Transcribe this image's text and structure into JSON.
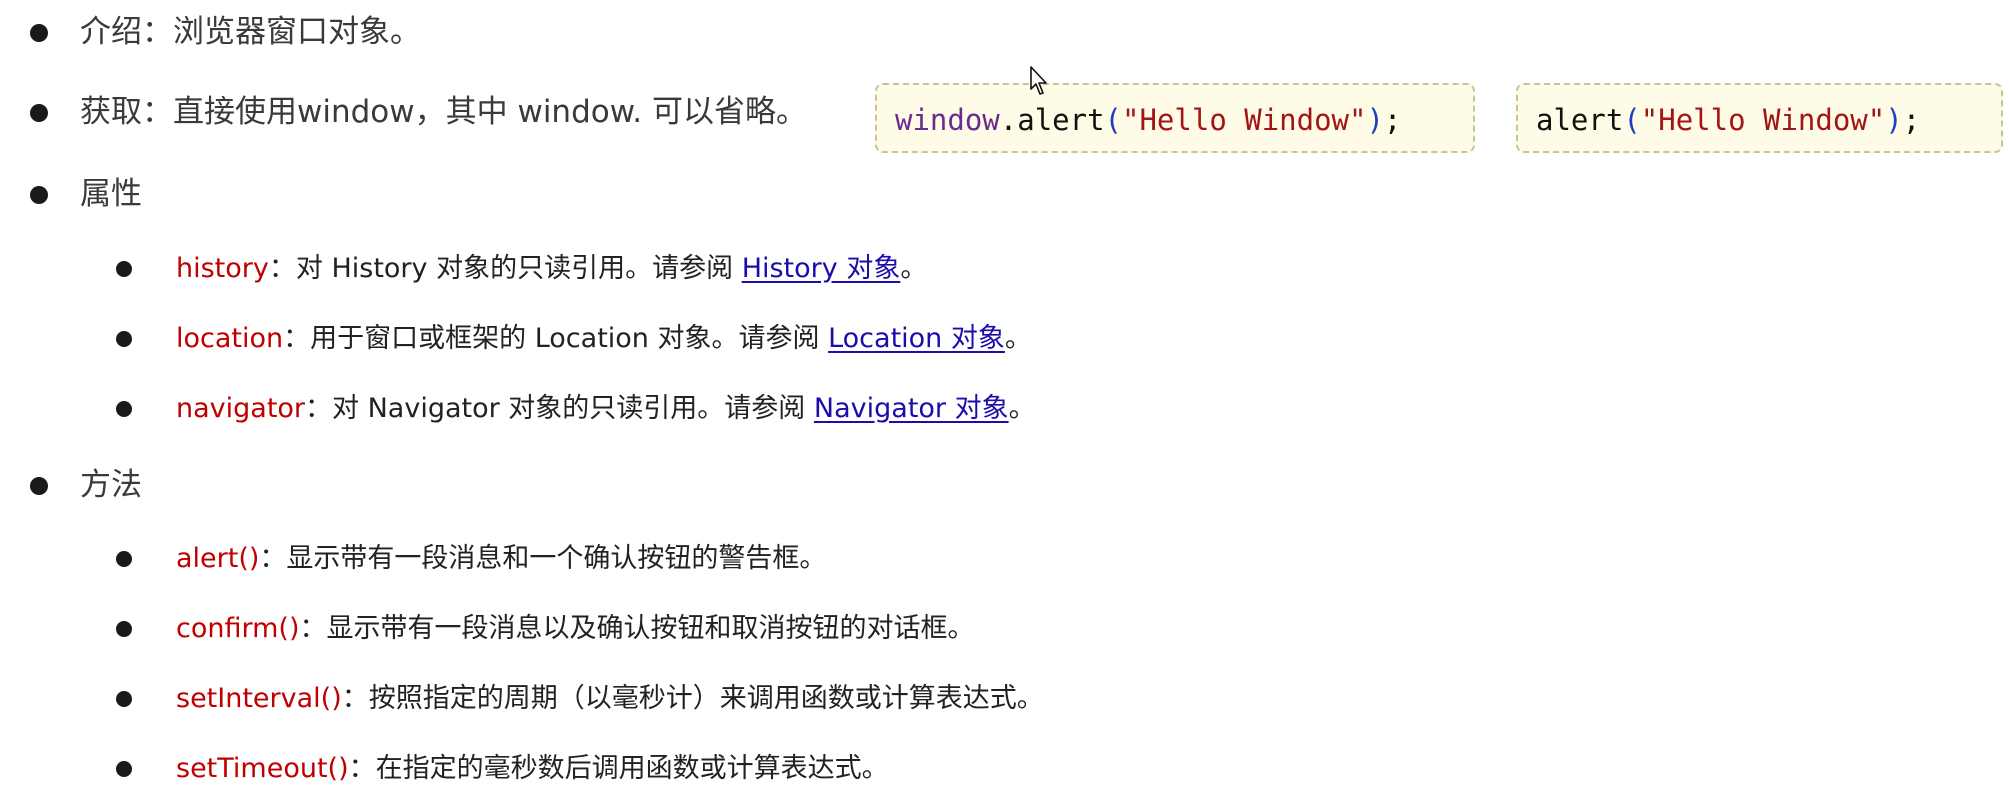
{
  "intro": {
    "label": "介绍：",
    "text": "浏览器窗口对象。"
  },
  "access": {
    "label": "获取：",
    "text": "直接使用window，其中 window. 可以省略。"
  },
  "code_examples": [
    {
      "object": "window",
      "dot": ".",
      "method": "alert",
      "open": "(",
      "argument": "\"Hello Window\"",
      "close": ")",
      "end": ";"
    },
    {
      "method": "alert",
      "open": "(",
      "argument": "\"Hello Window\"",
      "close": ")",
      "end": ";"
    }
  ],
  "properties": {
    "heading": "属性",
    "items": [
      {
        "name": "history",
        "description": "：对 History 对象的只读引用。请参阅 ",
        "link": "History 对象",
        "end": "。"
      },
      {
        "name": "location",
        "description": "：用于窗口或框架的 Location 对象。请参阅 ",
        "link": "Location 对象",
        "end": "。"
      },
      {
        "name": "navigator",
        "description": "：对 Navigator 对象的只读引用。请参阅 ",
        "link": "Navigator 对象",
        "end": "。"
      }
    ]
  },
  "methods": {
    "heading": "方法",
    "items": [
      {
        "name": "alert()",
        "description": "：显示带有一段消息和一个确认按钮的警告框。"
      },
      {
        "name": "confirm()",
        "description": "：显示带有一段消息以及确认按钮和取消按钮的对话框。"
      },
      {
        "name": "setInterval()",
        "description": "：按照指定的周期（以毫秒计）来调用函数或计算表达式。"
      },
      {
        "name": "setTimeout()",
        "description": "：在指定的毫秒数后调用函数或计算表达式。"
      }
    ]
  },
  "icons": {
    "cursor": "mouse-pointer-icon"
  }
}
